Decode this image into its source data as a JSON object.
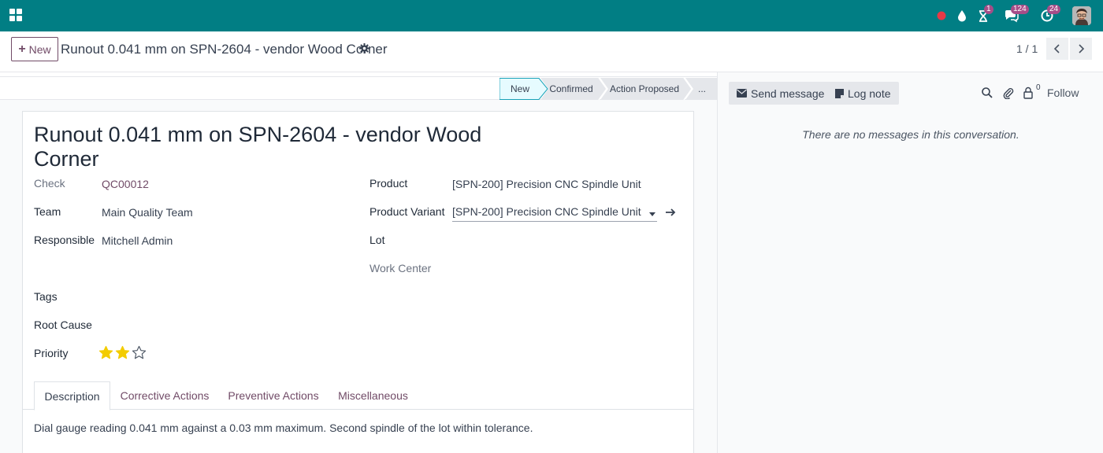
{
  "navbar": {
    "activity_badge": "1",
    "messages_badge": "124",
    "clock_badge": "24",
    "colors": {
      "bar": "#017e84",
      "badge": "#a64d88",
      "status_dot": "#e63946"
    }
  },
  "control_panel": {
    "new_label": "New",
    "breadcrumb": "Runout 0.041 mm on SPN-2604 - vendor Wood Corner",
    "pager": "1 / 1"
  },
  "statusbar": {
    "stages": [
      "New",
      "Confirmed",
      "Action Proposed",
      "..."
    ],
    "active_stage": "New",
    "colors": {
      "active_bg": "#e6fbff",
      "active_border": "#17a2b8",
      "inactive_bg": "#e5e7eb"
    }
  },
  "form": {
    "title": "Runout 0.041 mm on SPN-2604 - vendor Wood Corner",
    "left": {
      "check_label": "Check",
      "check_value": "QC00012",
      "team_label": "Team",
      "team_value": "Main Quality Team",
      "responsible_label": "Responsible",
      "responsible_value": "Mitchell Admin",
      "tags_label": "Tags",
      "root_cause_label": "Root Cause",
      "priority_label": "Priority",
      "priority_value": 2,
      "priority_max": 3
    },
    "right": {
      "product_label": "Product",
      "product_value": "[SPN-200] Precision CNC Spindle Unit",
      "variant_label": "Product Variant",
      "variant_value": "[SPN-200] Precision CNC Spindle Unit",
      "lot_label": "Lot",
      "workcenter_label": "Work Center"
    },
    "tabs": [
      "Description",
      "Corrective Actions",
      "Preventive Actions",
      "Miscellaneous"
    ],
    "active_tab": "Description",
    "description": "Dial gauge reading 0.041 mm against a 0.03 mm maximum. Second spindle of the lot within tolerance.",
    "colors": {
      "link": "#714b67",
      "star": "#f3cc00"
    }
  },
  "chatter": {
    "send_message_label": "Send message",
    "log_note_label": "Log note",
    "follower_count": "0",
    "follow_label": "Follow",
    "empty_text": "There are no messages in this conversation."
  }
}
